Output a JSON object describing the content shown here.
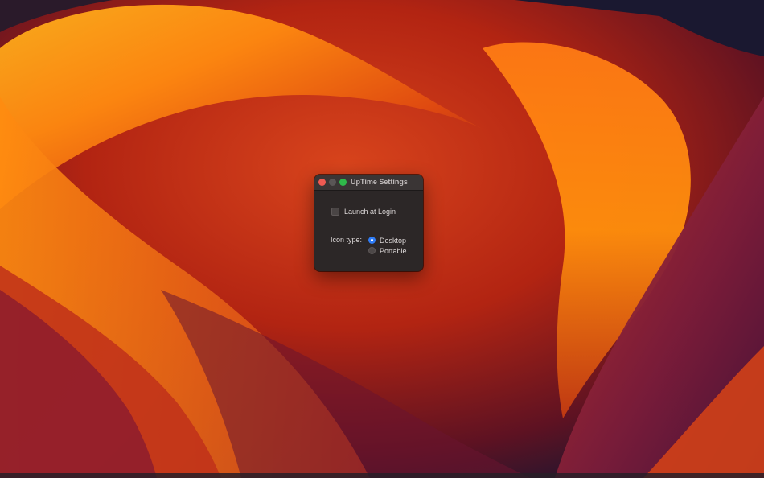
{
  "window": {
    "title": "UpTime Settings",
    "controls": {
      "close": "close-button",
      "minimize": "minimize-button",
      "zoom": "zoom-button"
    }
  },
  "settings": {
    "launch_at_login": {
      "label": "Launch at Login",
      "checked": false
    },
    "icon_type": {
      "label": "Icon type:",
      "options": [
        {
          "label": "Desktop",
          "selected": true
        },
        {
          "label": "Portable",
          "selected": false
        }
      ]
    }
  },
  "colors": {
    "close": "#ee5a52",
    "zoom": "#2fb94a",
    "accent": "#2f7cf6",
    "window_bg": "#2c2727"
  }
}
